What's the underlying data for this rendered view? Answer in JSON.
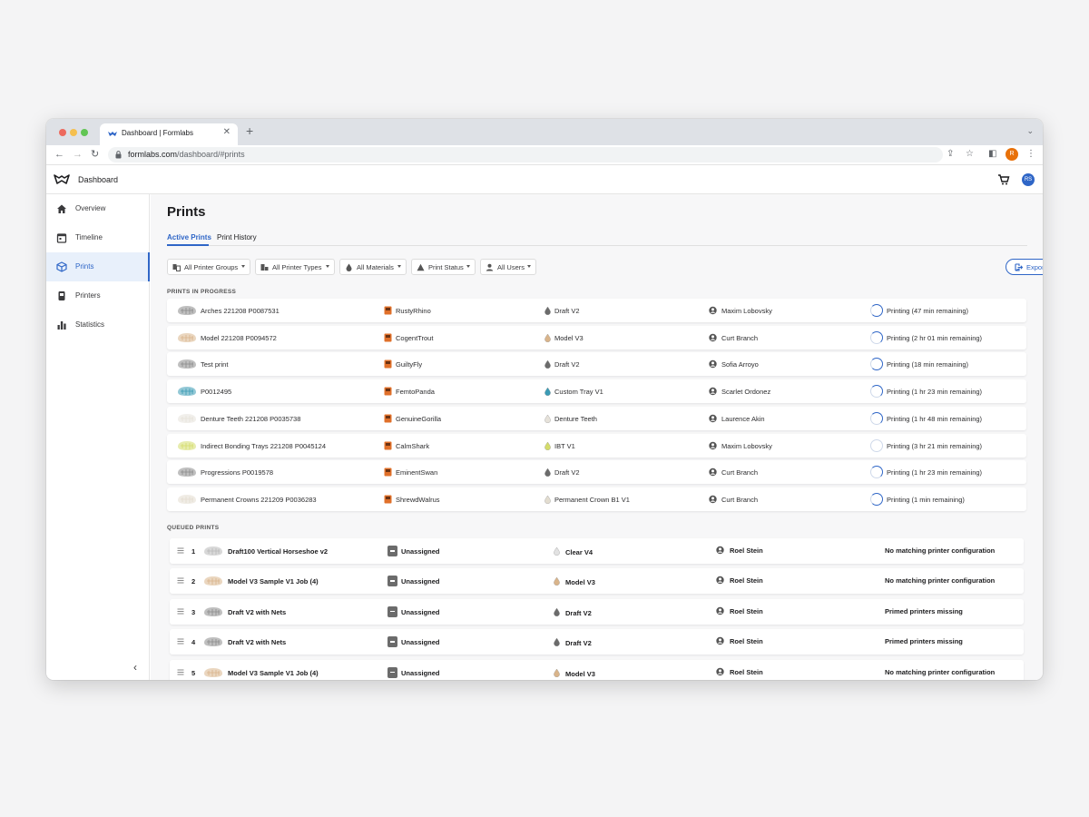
{
  "browser": {
    "tab_title": "Dashboard | Formlabs",
    "url_host": "formlabs.com",
    "url_path": "/dashboard/#prints",
    "profile_initial": "R"
  },
  "app": {
    "title": "Dashboard",
    "avatar_initials": "RS"
  },
  "sidebar": {
    "items": [
      {
        "label": "Overview",
        "icon": "home-icon"
      },
      {
        "label": "Timeline",
        "icon": "calendar-icon"
      },
      {
        "label": "Prints",
        "icon": "cube-icon",
        "active": true
      },
      {
        "label": "Printers",
        "icon": "printer-icon"
      },
      {
        "label": "Statistics",
        "icon": "bar-chart-icon"
      }
    ]
  },
  "page": {
    "title": "Prints",
    "tabs": [
      {
        "label": "Active Prints",
        "active": true
      },
      {
        "label": "Print History"
      }
    ],
    "filters": [
      {
        "label": "All Printer Groups",
        "icon": "printer-group-icon"
      },
      {
        "label": "All Printer Types",
        "icon": "printer-type-icon"
      },
      {
        "label": "All Materials",
        "icon": "drop-icon"
      },
      {
        "label": "Print Status",
        "icon": "warning-icon"
      },
      {
        "label": "All Users",
        "icon": "user-icon"
      }
    ],
    "export_label": "Export Data"
  },
  "in_progress": {
    "heading": "PRINTS IN PROGRESS",
    "rows": [
      {
        "name": "Arches 221208 P0087531",
        "printer": "RustyRhino",
        "material": "Draft V2",
        "material_color": "#6b6b6b",
        "user": "Maxim Lobovsky",
        "status": "Printing (47 min remaining)",
        "progress": 0.75
      },
      {
        "name": "Model 221208 P0094572",
        "printer": "CogentTrout",
        "material": "Model V3",
        "material_color": "#d9b48a",
        "user": "Curt Branch",
        "status": "Printing (2 hr 01 min remaining)",
        "progress": 0.5
      },
      {
        "name": "Test print",
        "printer": "GuiltyFly",
        "material": "Draft V2",
        "material_color": "#6b6b6b",
        "user": "Sofia Arroyo",
        "status": "Printing (18 min remaining)",
        "progress": 0.75
      },
      {
        "name": "P0012495",
        "printer": "FemtoPanda",
        "material": "Custom Tray V1",
        "material_color": "#3b9bb5",
        "user": "Scarlet Ordonez",
        "status": "Printing (1 hr 23 min remaining)",
        "progress": 0.5
      },
      {
        "name": "Denture Teeth 221208 P0035738",
        "printer": "GenuineGorilla",
        "material": "Denture Teeth",
        "material_color": "#e6e2da",
        "user": "Laurence Akin",
        "status": "Printing (1 hr 48 min remaining)",
        "progress": 0.5
      },
      {
        "name": "Indirect Bonding Trays 221208 P0045124",
        "printer": "CalmShark",
        "material": "IBT V1",
        "material_color": "#d4dc6a",
        "user": "Maxim Lobovsky",
        "status": "Printing (3 hr 21 min remaining)",
        "progress": 0.0
      },
      {
        "name": "Progressions P0019578",
        "printer": "EminentSwan",
        "material": "Draft V2",
        "material_color": "#6b6b6b",
        "user": "Curt Branch",
        "status": "Printing (1 hr 23 min remaining)",
        "progress": 0.5
      },
      {
        "name": "Permanent Crowns 221209 P0036283",
        "printer": "ShrewdWalrus",
        "material": "Permanent Crown B1 V1",
        "material_color": "#e3ddd0",
        "user": "Curt Branch",
        "status": "Printing (1 min remaining)",
        "progress": 0.75
      }
    ]
  },
  "queued": {
    "heading": "QUEUED PRINTS",
    "rows": [
      {
        "index": "1",
        "name": "Draft100 Vertical Horseshoe v2",
        "printer": "Unassigned",
        "material": "Clear V4",
        "material_color": "#e2e2e2",
        "user": "Roel Stein",
        "status": "No matching printer configuration"
      },
      {
        "index": "2",
        "name": "Model V3 Sample V1 Job (4)",
        "printer": "Unassigned",
        "material": "Model V3",
        "material_color": "#d9b48a",
        "user": "Roel Stein",
        "status": "No matching printer configuration"
      },
      {
        "index": "3",
        "name": "Draft V2 with Nets",
        "printer": "Unassigned",
        "material": "Draft V2",
        "material_color": "#6b6b6b",
        "user": "Roel Stein",
        "status": "Primed printers missing"
      },
      {
        "index": "4",
        "name": "Draft V2 with Nets",
        "printer": "Unassigned",
        "material": "Draft V2",
        "material_color": "#6b6b6b",
        "user": "Roel Stein",
        "status": "Primed printers missing"
      },
      {
        "index": "5",
        "name": "Model V3 Sample V1 Job (4)",
        "printer": "Unassigned",
        "material": "Model V3",
        "material_color": "#d9b48a",
        "user": "Roel Stein",
        "status": "No matching printer configuration"
      }
    ]
  },
  "colors": {
    "accent": "#2f66c7",
    "printer_orange": "#e0702a"
  }
}
